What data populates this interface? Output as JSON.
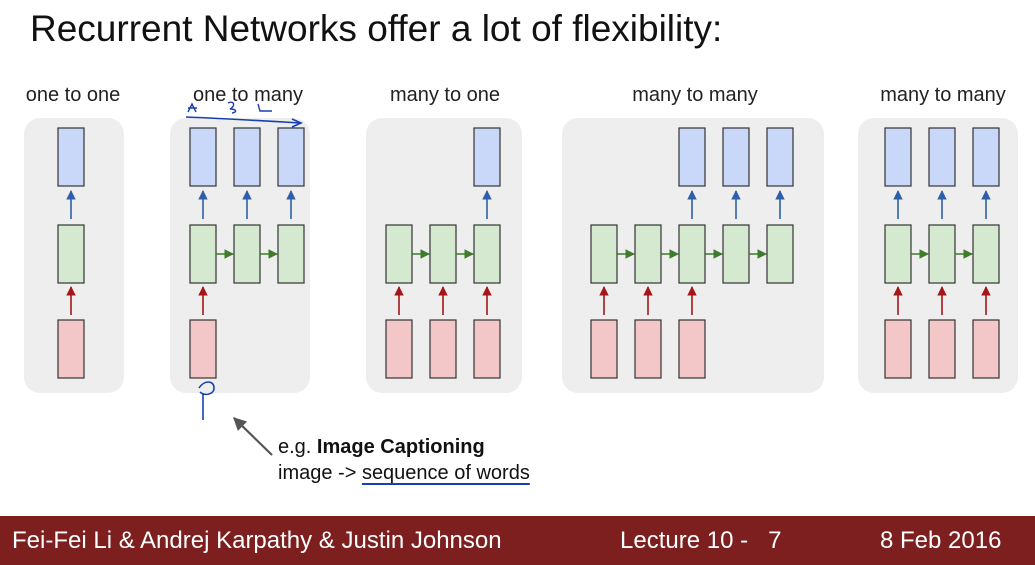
{
  "slide": {
    "title": "Recurrent Networks offer a lot of flexibility:"
  },
  "panels": [
    {
      "label": "one to one"
    },
    {
      "label": "one to many"
    },
    {
      "label": "many to one"
    },
    {
      "label": "many to many"
    },
    {
      "label": "many to many"
    }
  ],
  "caption": {
    "prefix": "e.g. ",
    "bold": "Image Captioning",
    "line2_prefix": "image -> ",
    "line2_underlined": "sequence of words"
  },
  "footer": {
    "authors": "Fei-Fei Li & Andrej Karpathy & Justin Johnson",
    "lecture": "Lecture 10 -",
    "page": "7",
    "date": "8 Feb 2016"
  },
  "colors": {
    "output_box": "#c9d7f8",
    "hidden_box": "#d4e9cf",
    "input_box": "#f3c7c7",
    "panel_bg": "#eeeeee",
    "footer_bg": "#7d1f1f",
    "blue_arrow": "#2f5fa8",
    "red_arrow": "#a4161a",
    "green_arrow": "#3e7b2a"
  }
}
